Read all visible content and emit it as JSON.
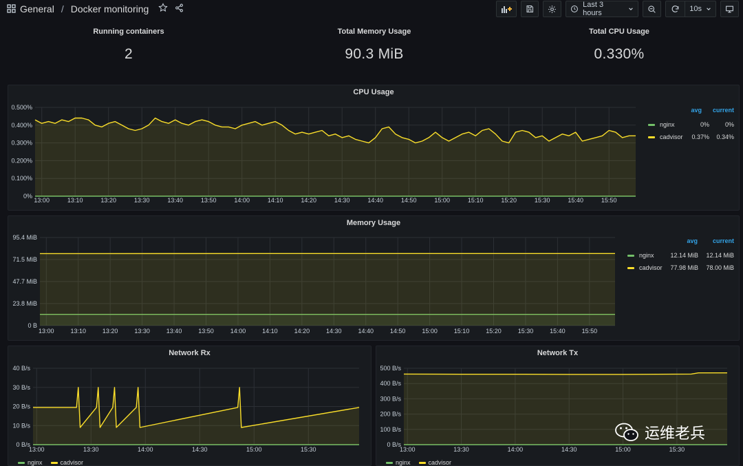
{
  "breadcrumb": {
    "folder": "General",
    "separator": "/",
    "dashboard": "Docker monitoring"
  },
  "toolbar": {
    "time_range": "Last 3 hours",
    "refresh_interval": "10s"
  },
  "stats": [
    {
      "title": "Running containers",
      "value": "2"
    },
    {
      "title": "Total Memory Usage",
      "value": "90.3 MiB"
    },
    {
      "title": "Total CPU Usage",
      "value": "0.330%"
    }
  ],
  "colors": {
    "nginx": "#73bf69",
    "cadvisor": "#fade2a",
    "legend_header": "#33a2e5",
    "panel_bg": "#181b1f",
    "page_bg": "#111217"
  },
  "cpu_panel": {
    "title": "CPU Usage",
    "legend": {
      "headers": [
        "avg",
        "current"
      ],
      "rows": [
        {
          "name": "nginx",
          "avg": "0%",
          "current": "0%"
        },
        {
          "name": "cadvisor",
          "avg": "0.37%",
          "current": "0.34%"
        }
      ]
    }
  },
  "mem_panel": {
    "title": "Memory Usage",
    "legend": {
      "headers": [
        "avg",
        "current"
      ],
      "rows": [
        {
          "name": "nginx",
          "avg": "12.14 MiB",
          "current": "12.14 MiB"
        },
        {
          "name": "cadvisor",
          "avg": "77.98 MiB",
          "current": "78.00 MiB"
        }
      ]
    }
  },
  "rx_panel": {
    "title": "Network Rx",
    "legend": [
      "nginx",
      "cadvisor"
    ]
  },
  "tx_panel": {
    "title": "Network Tx",
    "legend": [
      "nginx",
      "cadvisor"
    ]
  },
  "watermark": {
    "text": "运维老兵"
  },
  "chart_data": [
    {
      "type": "line",
      "title": "CPU Usage",
      "ylim": [
        0,
        0.5
      ],
      "y_ticks": [
        "0%",
        "0.100%",
        "0.200%",
        "0.300%",
        "0.400%",
        "0.500%"
      ],
      "x_ticks": [
        "13:00",
        "13:10",
        "13:20",
        "13:30",
        "13:40",
        "13:50",
        "14:00",
        "14:10",
        "14:20",
        "14:30",
        "14:40",
        "14:50",
        "15:00",
        "15:10",
        "15:20",
        "15:30",
        "15:40",
        "15:50"
      ],
      "series": [
        {
          "name": "nginx",
          "x": [
            "12:58",
            "15:58"
          ],
          "values": [
            0,
            0
          ]
        },
        {
          "name": "cadvisor",
          "x": [
            "12:58",
            "13:00",
            "13:02",
            "13:04",
            "13:06",
            "13:08",
            "13:10",
            "13:12",
            "13:14",
            "13:16",
            "13:18",
            "13:20",
            "13:22",
            "13:24",
            "13:26",
            "13:28",
            "13:30",
            "13:32",
            "13:34",
            "13:36",
            "13:38",
            "13:40",
            "13:42",
            "13:44",
            "13:46",
            "13:48",
            "13:50",
            "13:52",
            "13:54",
            "13:56",
            "13:58",
            "14:00",
            "14:02",
            "14:04",
            "14:06",
            "14:08",
            "14:10",
            "14:12",
            "14:14",
            "14:16",
            "14:18",
            "14:20",
            "14:22",
            "14:24",
            "14:26",
            "14:28",
            "14:30",
            "14:32",
            "14:34",
            "14:36",
            "14:38",
            "14:40",
            "14:42",
            "14:44",
            "14:46",
            "14:48",
            "14:50",
            "14:52",
            "14:54",
            "14:56",
            "14:58",
            "15:00",
            "15:02",
            "15:04",
            "15:06",
            "15:08",
            "15:10",
            "15:12",
            "15:14",
            "15:16",
            "15:18",
            "15:20",
            "15:22",
            "15:24",
            "15:26",
            "15:28",
            "15:30",
            "15:32",
            "15:34",
            "15:36",
            "15:38",
            "15:40",
            "15:42",
            "15:44",
            "15:46",
            "15:48",
            "15:50",
            "15:52",
            "15:54",
            "15:56",
            "15:58"
          ],
          "values": [
            0.43,
            0.41,
            0.42,
            0.41,
            0.43,
            0.42,
            0.44,
            0.44,
            0.43,
            0.4,
            0.39,
            0.41,
            0.42,
            0.4,
            0.38,
            0.37,
            0.38,
            0.4,
            0.44,
            0.42,
            0.41,
            0.43,
            0.41,
            0.4,
            0.42,
            0.43,
            0.42,
            0.4,
            0.39,
            0.39,
            0.38,
            0.4,
            0.41,
            0.42,
            0.4,
            0.41,
            0.42,
            0.4,
            0.37,
            0.35,
            0.36,
            0.35,
            0.36,
            0.37,
            0.34,
            0.35,
            0.33,
            0.34,
            0.32,
            0.31,
            0.3,
            0.33,
            0.38,
            0.39,
            0.35,
            0.33,
            0.32,
            0.3,
            0.31,
            0.33,
            0.36,
            0.33,
            0.31,
            0.33,
            0.35,
            0.36,
            0.34,
            0.37,
            0.38,
            0.35,
            0.31,
            0.3,
            0.36,
            0.37,
            0.36,
            0.33,
            0.34,
            0.31,
            0.33,
            0.35,
            0.34,
            0.36,
            0.31,
            0.32,
            0.33,
            0.34,
            0.37,
            0.36,
            0.33,
            0.34,
            0.34
          ]
        }
      ]
    },
    {
      "type": "line",
      "title": "Memory Usage",
      "ylim": [
        0,
        95.4
      ],
      "y_ticks": [
        "0 B",
        "23.8 MiB",
        "47.7 MiB",
        "71.5 MiB",
        "95.4 MiB"
      ],
      "x_ticks": [
        "13:00",
        "13:10",
        "13:20",
        "13:30",
        "13:40",
        "13:50",
        "14:00",
        "14:10",
        "14:20",
        "14:30",
        "14:40",
        "14:50",
        "15:00",
        "15:10",
        "15:20",
        "15:30",
        "15:40",
        "15:50"
      ],
      "series": [
        {
          "name": "nginx",
          "x": [
            "12:58",
            "15:58"
          ],
          "values": [
            12.14,
            12.14
          ]
        },
        {
          "name": "cadvisor",
          "x": [
            "12:58",
            "15:58"
          ],
          "values": [
            77.98,
            78.0
          ]
        }
      ]
    },
    {
      "type": "line",
      "title": "Network Rx",
      "ylim": [
        0,
        40
      ],
      "y_ticks": [
        "0 B/s",
        "10 B/s",
        "20 B/s",
        "30 B/s",
        "40 B/s"
      ],
      "x_ticks": [
        "13:00",
        "13:30",
        "14:00",
        "14:30",
        "15:00",
        "15:30"
      ],
      "series": [
        {
          "name": "nginx",
          "x": [
            "12:58",
            "15:58"
          ],
          "values": [
            0,
            0
          ]
        },
        {
          "name": "cadvisor",
          "x": [
            "12:58",
            "13:22",
            "13:23",
            "13:24",
            "13:33",
            "13:34",
            "13:35",
            "13:42",
            "13:43",
            "13:44",
            "13:55",
            "13:56",
            "13:57",
            "14:51",
            "14:52",
            "14:53",
            "15:58"
          ],
          "values": [
            19.5,
            19.5,
            30,
            9,
            19.5,
            30,
            9,
            19.5,
            30,
            9,
            19.5,
            30,
            9,
            19.5,
            30,
            9,
            19.5
          ]
        }
      ]
    },
    {
      "type": "line",
      "title": "Network Tx",
      "ylim": [
        0,
        500
      ],
      "y_ticks": [
        "0 B/s",
        "100 B/s",
        "200 B/s",
        "300 B/s",
        "400 B/s",
        "500 B/s"
      ],
      "x_ticks": [
        "13:00",
        "13:30",
        "14:00",
        "14:30",
        "15:00",
        "15:30"
      ],
      "series": [
        {
          "name": "nginx",
          "x": [
            "12:58",
            "15:58"
          ],
          "values": [
            0,
            0
          ]
        },
        {
          "name": "cadvisor",
          "x": [
            "12:58",
            "13:30",
            "14:00",
            "14:30",
            "15:00",
            "15:38",
            "15:42",
            "15:58"
          ],
          "values": [
            462,
            461,
            461,
            460,
            460,
            462,
            470,
            470
          ]
        }
      ]
    }
  ]
}
